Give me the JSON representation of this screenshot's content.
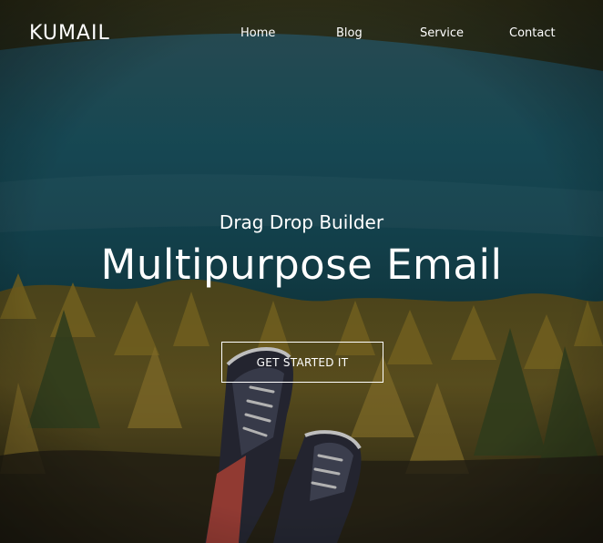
{
  "header": {
    "logo": "KUMAIL",
    "nav": [
      {
        "label": "Home"
      },
      {
        "label": "Blog"
      },
      {
        "label": "Service"
      },
      {
        "label": "Contact"
      }
    ]
  },
  "hero": {
    "subtitle": "Drag Drop Builder",
    "title": "Multipurpose Email",
    "cta_label": "GET STARTED IT",
    "background_image": "lake-forest-sneakers-photo"
  },
  "colors": {
    "text": "#ffffff",
    "lake": "#1f5a66",
    "forest": "#7a6a2a"
  }
}
